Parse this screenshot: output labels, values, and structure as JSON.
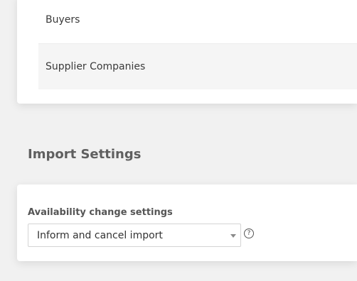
{
  "roles_list": {
    "items": [
      {
        "label": "Buyers"
      },
      {
        "label": "Supplier Companies"
      }
    ]
  },
  "import_settings": {
    "title": "Import Settings",
    "availability_field": {
      "label": "Availability change settings",
      "selected": "Inform and cancel import"
    },
    "help_glyph": "?"
  }
}
